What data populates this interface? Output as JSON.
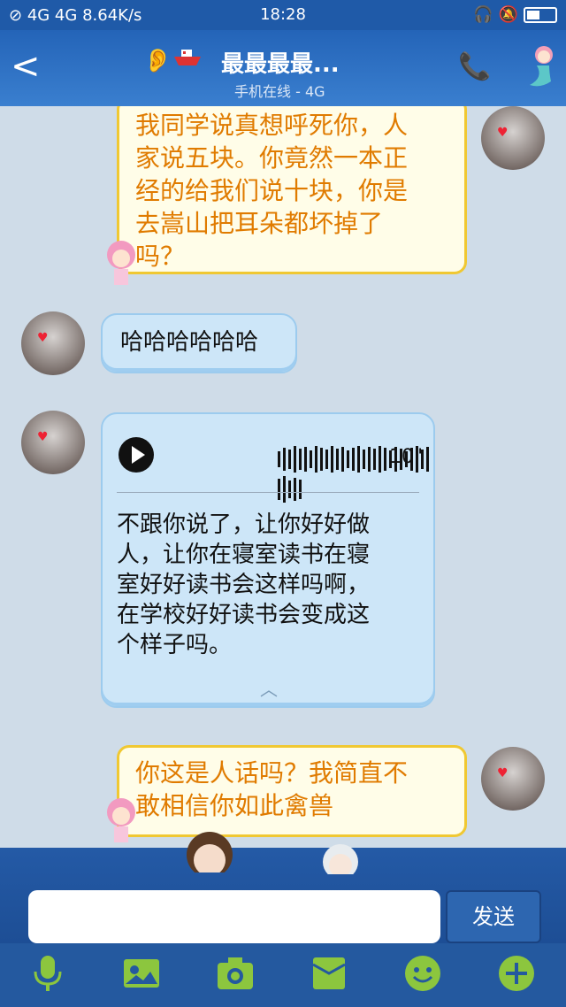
{
  "status_bar": {
    "network": "4G 4G",
    "speed": "8.64K/s",
    "time": "18:28"
  },
  "header": {
    "back_label": "<",
    "title": "最最最最...",
    "subtitle": "手机在线 - 4G"
  },
  "messages": [
    {
      "from": "me",
      "text": "我同学说真想呼死你，人家说五块。你竟然一本正经的给我们说十块，你是去嵩山把耳朵都坏掉了吗？",
      "lines": [
        "我同学说真想呼死你，人",
        "家说五块。你竟然一本正",
        "经的给我们说十块，你是",
        "去嵩山把耳朵都坏掉了",
        "吗？"
      ]
    },
    {
      "from": "them",
      "text": "哈哈哈哈哈哈"
    },
    {
      "from": "them",
      "type": "voice",
      "duration": "10\"",
      "transcript_lines": [
        "不跟你说了，让你好好做",
        "人，让你在寝室读书在寝",
        "室好好读书会这样吗啊，",
        "在学校好好读书会变成这",
        "个样子吗。"
      ]
    },
    {
      "from": "me",
      "lines": [
        "你这是人话吗？我简直不",
        "敢相信你如此禽兽"
      ]
    }
  ],
  "input": {
    "value": "",
    "send_label": "发送"
  },
  "toolbar": {
    "icons": [
      "mic-icon",
      "image-icon",
      "camera-icon",
      "folder-icon",
      "emoji-icon",
      "plus-icon"
    ]
  },
  "colors": {
    "header_blue": "#2464b8",
    "my_bubble_text": "#e07b00",
    "my_bubble_border": "#f0c832",
    "their_bubble": "#cde6f8"
  }
}
